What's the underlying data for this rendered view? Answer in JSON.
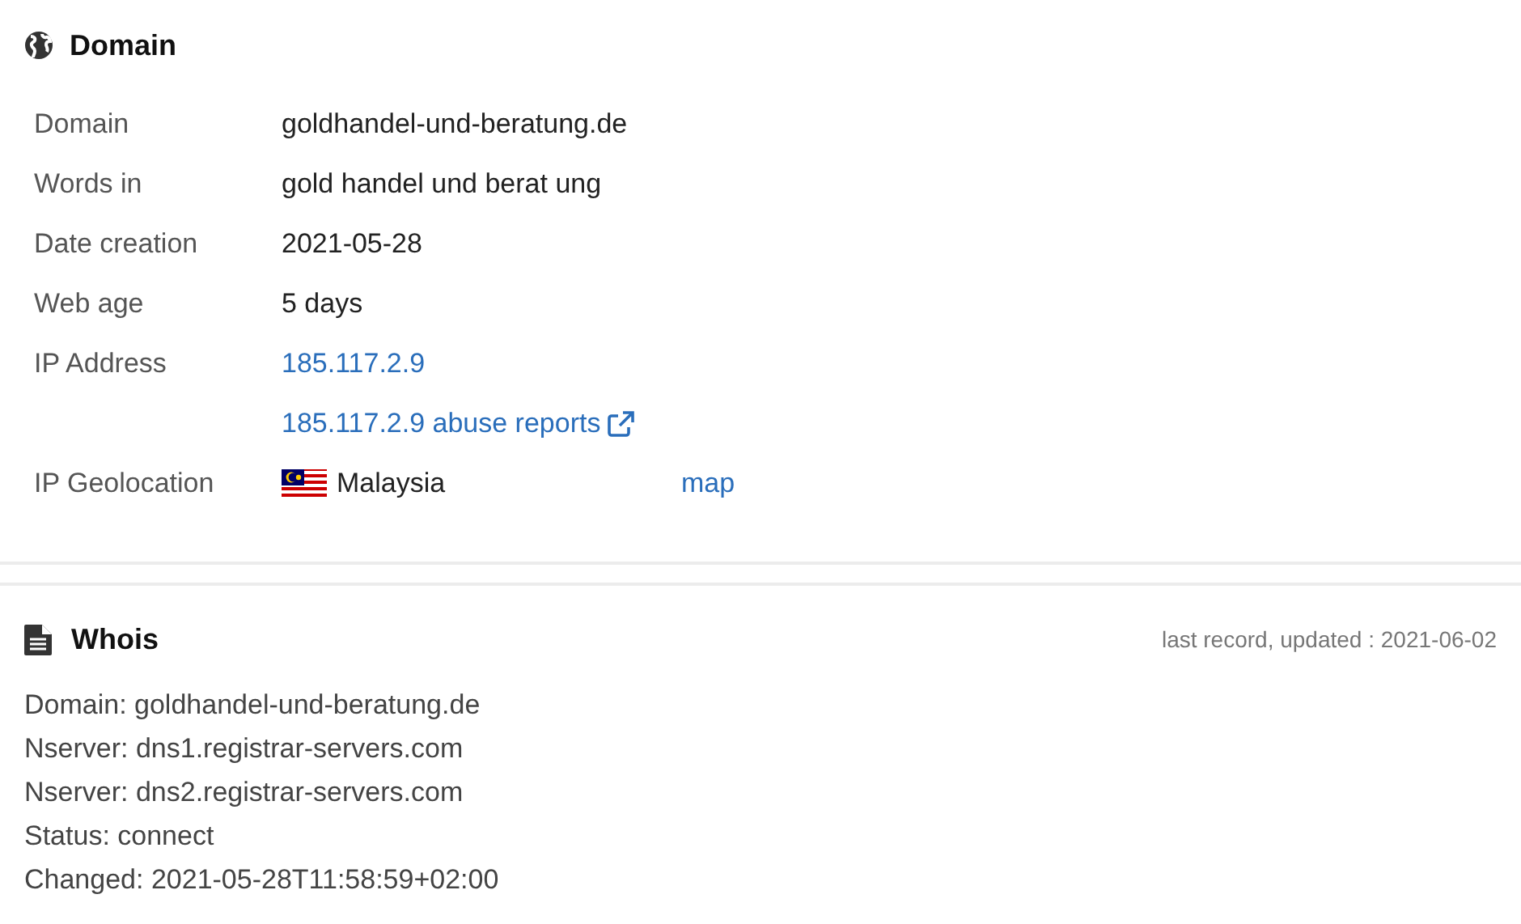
{
  "domain_section": {
    "title": "Domain",
    "rows": [
      {
        "kind": "text",
        "label": "Domain",
        "value": "goldhandel-und-beratung.de"
      },
      {
        "kind": "text",
        "label": "Words in",
        "value": "gold handel und berat ung"
      },
      {
        "kind": "text",
        "label": "Date creation",
        "value": "2021-05-28"
      },
      {
        "kind": "text",
        "label": "Web age",
        "value": "5 days"
      },
      {
        "kind": "link",
        "label": "IP Address",
        "value": "185.117.2.9"
      },
      {
        "kind": "external_link",
        "value": "185.117.2.9 abuse reports"
      },
      {
        "kind": "geo",
        "label": "IP Geolocation",
        "value": "Malaysia",
        "link": "map"
      }
    ]
  },
  "whois_section": {
    "title": "Whois",
    "updated": "last record, updated : 2021-06-02",
    "lines": [
      "Domain: goldhandel-und-beratung.de",
      "Nserver: dns1.registrar-servers.com",
      "Nserver: dns2.registrar-servers.com",
      "Status: connect",
      "Changed: 2021-05-28T11:58:59+02:00"
    ]
  }
}
